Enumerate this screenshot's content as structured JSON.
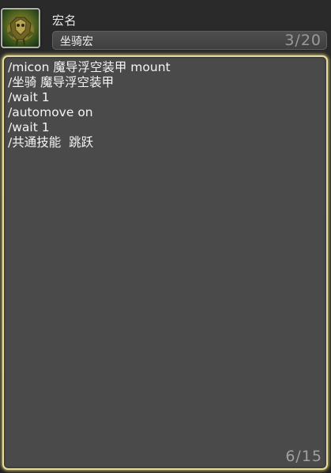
{
  "macro": {
    "icon": "mount-icon",
    "name_label": "宏名",
    "name_value": "坐骑宏",
    "name_count": "3/20"
  },
  "editor": {
    "lines": [
      "/micon 魔导浮空装甲 mount",
      "/坐骑 魔导浮空装甲",
      "/wait 1",
      "/automove on",
      "/wait 1",
      "/共通技能  跳跃"
    ],
    "line_count": "6/15"
  },
  "colors": {
    "background": "#242424",
    "field": "#464646",
    "editor": "#4a4a4a",
    "focus_border": "#e8dc9a",
    "text": "#f5f5f5",
    "counter": "#a0a0a0"
  }
}
